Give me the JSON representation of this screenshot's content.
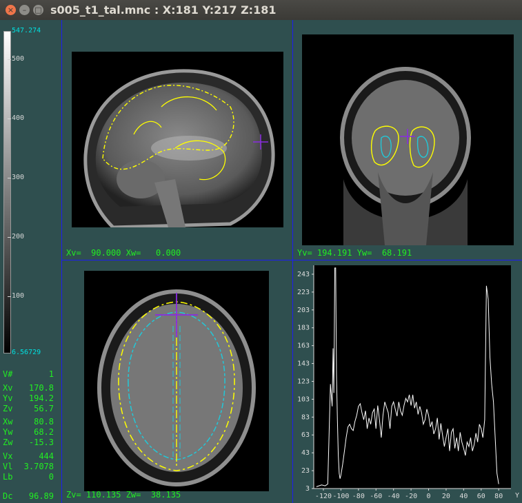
{
  "window": {
    "title": "s005_t1_tal.mnc : X:181 Y:217 Z:181",
    "close_icon": "close-icon",
    "minimize_icon": "minimize-icon",
    "maximize_icon": "maximize-icon"
  },
  "colorbar": {
    "max_label": "547.274",
    "min_label": "6.56729",
    "ticks": [
      "500",
      "400",
      "300",
      "200",
      "100"
    ]
  },
  "info": [
    {
      "label": "V#",
      "value": "1"
    },
    {
      "label": "Xv",
      "value": "170.8"
    },
    {
      "label": "Yv",
      "value": "194.2"
    },
    {
      "label": "Zv",
      "value": "56.7"
    },
    {
      "label": "Xw",
      "value": "80.8"
    },
    {
      "label": "Yw",
      "value": "68.2"
    },
    {
      "label": "Zw",
      "value": "-15.3"
    },
    {
      "label": "Vx",
      "value": "444"
    },
    {
      "label": "Vl",
      "value": "3.7078"
    },
    {
      "label": "Lb",
      "value": "0"
    },
    {
      "label": "Dc",
      "value": "96.89"
    }
  ],
  "views": {
    "sagittal_coord": "Xv=  90.000 Xw=   0.000",
    "coronal_coord": "Yv= 194.191 Yw=  68.191",
    "axial_coord": "Zv= 110.135 Zw=  38.135"
  },
  "colors": {
    "contour_outer": "#ffff00",
    "contour_inner": "#22c8d8",
    "cursor": "#8a2be2",
    "text_green": "#22ee22",
    "cyan": "#00e0e0",
    "separator": "#1d1df0"
  },
  "histogram": {
    "y_ticks": [
      "243",
      "223",
      "203",
      "183",
      "163",
      "143",
      "123",
      "103",
      "83",
      "63",
      "43",
      "23",
      "3"
    ],
    "x_ticks": [
      "-120",
      "-100",
      "-80",
      "-60",
      "-40",
      "-20",
      "0",
      "20",
      "40",
      "60",
      "80"
    ],
    "axis_label": "Y",
    "chart_data": {
      "type": "line",
      "ylim": [
        3,
        253
      ],
      "xlim": [
        -131,
        94
      ],
      "x": [
        -128,
        -122,
        -118,
        -115,
        -112,
        -110,
        -109,
        -108,
        -107,
        -106,
        -105,
        -104,
        -103,
        -102,
        -101,
        -100,
        -98,
        -96,
        -94,
        -92,
        -90,
        -88,
        -86,
        -84,
        -82,
        -80,
        -78,
        -76,
        -74,
        -72,
        -70,
        -68,
        -66,
        -64,
        -62,
        -60,
        -58,
        -56,
        -54,
        -52,
        -50,
        -48,
        -46,
        -44,
        -42,
        -40,
        -38,
        -36,
        -34,
        -32,
        -30,
        -28,
        -26,
        -24,
        -22,
        -20,
        -18,
        -16,
        -14,
        -12,
        -10,
        -8,
        -6,
        -4,
        -2,
        0,
        2,
        4,
        6,
        8,
        10,
        12,
        14,
        16,
        18,
        20,
        22,
        24,
        26,
        28,
        30,
        32,
        34,
        36,
        38,
        40,
        42,
        44,
        46,
        48,
        50,
        52,
        54,
        56,
        58,
        60,
        62,
        64,
        66,
        68,
        70,
        72,
        74,
        76,
        78,
        80,
        82,
        83,
        84,
        85,
        86,
        87,
        88,
        89,
        90,
        92
      ],
      "values": [
        5,
        7,
        6,
        8,
        120,
        95,
        160,
        110,
        250,
        250,
        130,
        80,
        40,
        20,
        14,
        18,
        30,
        45,
        60,
        72,
        75,
        70,
        68,
        78,
        85,
        95,
        98,
        88,
        80,
        90,
        70,
        82,
        75,
        88,
        92,
        70,
        96,
        80,
        60,
        85,
        100,
        94,
        88,
        70,
        95,
        100,
        92,
        84,
        100,
        90,
        85,
        96,
        104,
        100,
        108,
        96,
        108,
        93,
        100,
        86,
        95,
        88,
        75,
        80,
        92,
        85,
        72,
        78,
        64,
        70,
        82,
        58,
        76,
        62,
        50,
        60,
        70,
        45,
        66,
        70,
        48,
        60,
        45,
        66,
        55,
        48,
        40,
        55,
        50,
        60,
        45,
        52,
        65,
        55,
        75,
        70,
        60,
        80,
        230,
        215,
        150,
        120,
        100,
        60,
        20,
        8
      ]
    }
  }
}
